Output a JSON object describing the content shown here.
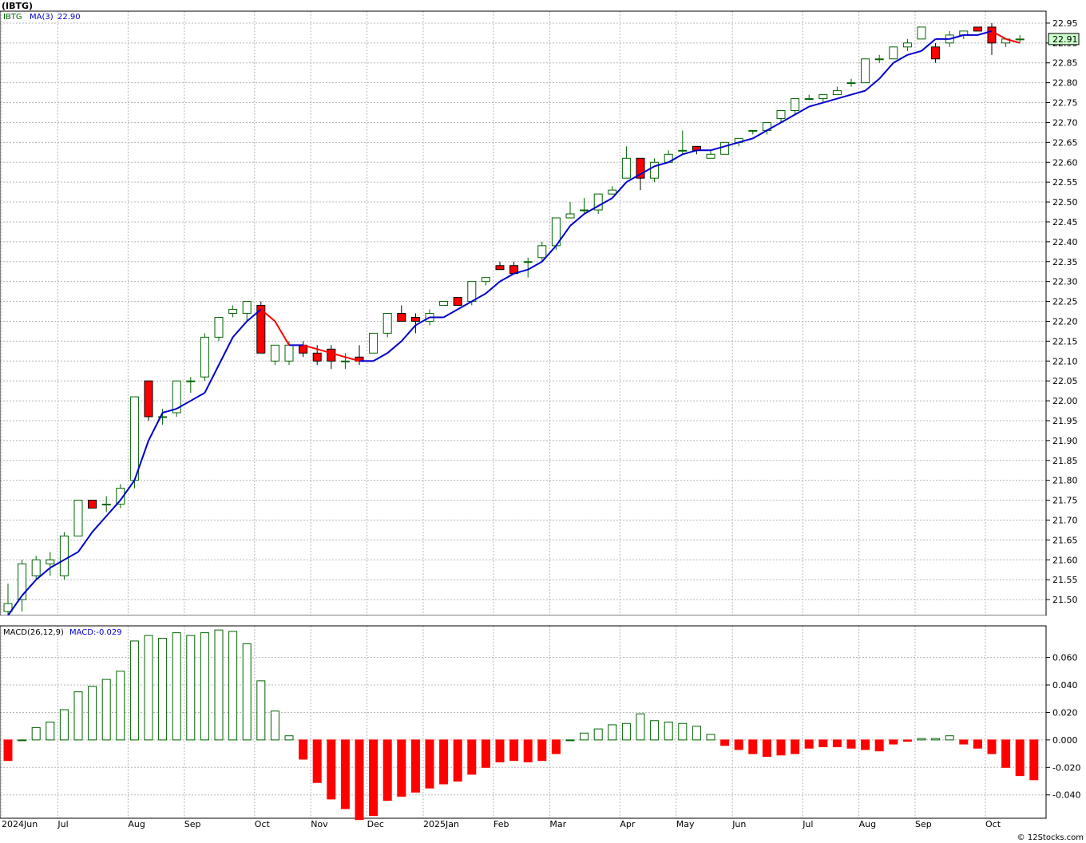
{
  "header": {
    "ticker_title": "(IBTG)"
  },
  "footer": {
    "watermark": "© 12Stocks.com"
  },
  "colors": {
    "up": "#006400",
    "down": "#ff0000",
    "ma_up": "#0000cc",
    "ma_down": "#ff0000",
    "grid": "#b8b8b8",
    "frame": "#000000",
    "price_tag_bg": "#ccffcc"
  },
  "chart_data": [
    {
      "type": "candlestick",
      "panel": "price",
      "ticker_label": "IBTG",
      "ma_label": "MA(3)",
      "ma_value_label": "22.90",
      "last_price_label": "22.91",
      "ylim": [
        21.46,
        22.98
      ],
      "y_ticks": [
        "21.50",
        "21.55",
        "21.60",
        "21.65",
        "21.70",
        "21.75",
        "21.80",
        "21.85",
        "21.90",
        "21.95",
        "22.00",
        "22.05",
        "22.10",
        "22.15",
        "22.20",
        "22.25",
        "22.30",
        "22.35",
        "22.40",
        "22.45",
        "22.50",
        "22.55",
        "22.60",
        "22.65",
        "22.70",
        "22.75",
        "22.80",
        "22.85",
        "22.90",
        "22.95"
      ],
      "x_labels": [
        "2024Jun",
        "Jul",
        "Aug",
        "Sep",
        "Oct",
        "Nov",
        "Dec",
        "2025Jan",
        "Feb",
        "Mar",
        "Apr",
        "May",
        "Jun",
        "Jul",
        "Aug",
        "Sep",
        "Oct"
      ],
      "candles": [
        {
          "o": 21.47,
          "h": 21.54,
          "l": 21.46,
          "c": 21.49
        },
        {
          "o": 21.5,
          "h": 21.6,
          "l": 21.47,
          "c": 21.59
        },
        {
          "o": 21.56,
          "h": 21.61,
          "l": 21.55,
          "c": 21.6
        },
        {
          "o": 21.59,
          "h": 21.62,
          "l": 21.56,
          "c": 21.6
        },
        {
          "o": 21.56,
          "h": 21.67,
          "l": 21.55,
          "c": 21.66
        },
        {
          "o": 21.66,
          "h": 21.75,
          "l": 21.66,
          "c": 21.75
        },
        {
          "o": 21.75,
          "h": 21.75,
          "l": 21.73,
          "c": 21.73
        },
        {
          "o": 21.74,
          "h": 21.76,
          "l": 21.72,
          "c": 21.74
        },
        {
          "o": 21.74,
          "h": 21.79,
          "l": 21.73,
          "c": 21.78
        },
        {
          "o": 21.8,
          "h": 22.01,
          "l": 21.78,
          "c": 22.01
        },
        {
          "o": 22.05,
          "h": 22.05,
          "l": 21.95,
          "c": 21.96
        },
        {
          "o": 21.96,
          "h": 21.98,
          "l": 21.94,
          "c": 21.96
        },
        {
          "o": 21.97,
          "h": 22.05,
          "l": 21.96,
          "c": 22.05
        },
        {
          "o": 22.05,
          "h": 22.06,
          "l": 22.02,
          "c": 22.05
        },
        {
          "o": 22.06,
          "h": 22.17,
          "l": 22.05,
          "c": 22.16
        },
        {
          "o": 22.16,
          "h": 22.21,
          "l": 22.15,
          "c": 22.21
        },
        {
          "o": 22.22,
          "h": 22.24,
          "l": 22.21,
          "c": 22.23
        },
        {
          "o": 22.22,
          "h": 22.25,
          "l": 22.2,
          "c": 22.25
        },
        {
          "o": 22.24,
          "h": 22.25,
          "l": 22.12,
          "c": 22.12
        },
        {
          "o": 22.1,
          "h": 22.14,
          "l": 22.09,
          "c": 22.14
        },
        {
          "o": 22.1,
          "h": 22.15,
          "l": 22.09,
          "c": 22.14
        },
        {
          "o": 22.14,
          "h": 22.15,
          "l": 22.11,
          "c": 22.12
        },
        {
          "o": 22.12,
          "h": 22.14,
          "l": 22.09,
          "c": 22.1
        },
        {
          "o": 22.13,
          "h": 22.14,
          "l": 22.08,
          "c": 22.1
        },
        {
          "o": 22.1,
          "h": 22.12,
          "l": 22.08,
          "c": 22.1
        },
        {
          "o": 22.11,
          "h": 22.14,
          "l": 22.09,
          "c": 22.1
        },
        {
          "o": 22.12,
          "h": 22.17,
          "l": 22.12,
          "c": 22.17
        },
        {
          "o": 22.17,
          "h": 22.22,
          "l": 22.16,
          "c": 22.22
        },
        {
          "o": 22.22,
          "h": 22.24,
          "l": 22.2,
          "c": 22.2
        },
        {
          "o": 22.21,
          "h": 22.22,
          "l": 22.17,
          "c": 22.2
        },
        {
          "o": 22.2,
          "h": 22.23,
          "l": 22.19,
          "c": 22.22
        },
        {
          "o": 22.24,
          "h": 22.25,
          "l": 22.24,
          "c": 22.25
        },
        {
          "o": 22.26,
          "h": 22.26,
          "l": 22.24,
          "c": 22.24
        },
        {
          "o": 22.25,
          "h": 22.3,
          "l": 22.24,
          "c": 22.3
        },
        {
          "o": 22.3,
          "h": 22.31,
          "l": 22.29,
          "c": 22.31
        },
        {
          "o": 22.34,
          "h": 22.35,
          "l": 22.33,
          "c": 22.33
        },
        {
          "o": 22.34,
          "h": 22.35,
          "l": 22.32,
          "c": 22.32
        },
        {
          "o": 22.35,
          "h": 22.36,
          "l": 22.31,
          "c": 22.35
        },
        {
          "o": 22.36,
          "h": 22.4,
          "l": 22.35,
          "c": 22.39
        },
        {
          "o": 22.39,
          "h": 22.46,
          "l": 22.38,
          "c": 22.46
        },
        {
          "o": 22.46,
          "h": 22.5,
          "l": 22.46,
          "c": 22.47
        },
        {
          "o": 22.48,
          "h": 22.51,
          "l": 22.47,
          "c": 22.48
        },
        {
          "o": 22.48,
          "h": 22.52,
          "l": 22.47,
          "c": 22.52
        },
        {
          "o": 22.52,
          "h": 22.54,
          "l": 22.52,
          "c": 22.53
        },
        {
          "o": 22.56,
          "h": 22.64,
          "l": 22.56,
          "c": 22.61
        },
        {
          "o": 22.61,
          "h": 22.61,
          "l": 22.53,
          "c": 22.56
        },
        {
          "o": 22.56,
          "h": 22.61,
          "l": 22.55,
          "c": 22.6
        },
        {
          "o": 22.6,
          "h": 22.63,
          "l": 22.6,
          "c": 22.62
        },
        {
          "o": 22.63,
          "h": 22.68,
          "l": 22.62,
          "c": 22.63
        },
        {
          "o": 22.64,
          "h": 22.64,
          "l": 22.62,
          "c": 22.63
        },
        {
          "o": 22.61,
          "h": 22.63,
          "l": 22.61,
          "c": 22.62
        },
        {
          "o": 22.62,
          "h": 22.65,
          "l": 22.62,
          "c": 22.65
        },
        {
          "o": 22.65,
          "h": 22.66,
          "l": 22.64,
          "c": 22.66
        },
        {
          "o": 22.68,
          "h": 22.68,
          "l": 22.67,
          "c": 22.68
        },
        {
          "o": 22.68,
          "h": 22.7,
          "l": 22.67,
          "c": 22.7
        },
        {
          "o": 22.71,
          "h": 22.73,
          "l": 22.7,
          "c": 22.73
        },
        {
          "o": 22.73,
          "h": 22.76,
          "l": 22.72,
          "c": 22.76
        },
        {
          "o": 22.76,
          "h": 22.77,
          "l": 22.76,
          "c": 22.76
        },
        {
          "o": 22.76,
          "h": 22.77,
          "l": 22.75,
          "c": 22.77
        },
        {
          "o": 22.77,
          "h": 22.79,
          "l": 22.77,
          "c": 22.78
        },
        {
          "o": 22.8,
          "h": 22.81,
          "l": 22.79,
          "c": 22.8
        },
        {
          "o": 22.8,
          "h": 22.86,
          "l": 22.8,
          "c": 22.86
        },
        {
          "o": 22.86,
          "h": 22.87,
          "l": 22.85,
          "c": 22.86
        },
        {
          "o": 22.86,
          "h": 22.89,
          "l": 22.86,
          "c": 22.89
        },
        {
          "o": 22.89,
          "h": 22.91,
          "l": 22.88,
          "c": 22.9
        },
        {
          "o": 22.91,
          "h": 22.94,
          "l": 22.91,
          "c": 22.94
        },
        {
          "o": 22.89,
          "h": 22.9,
          "l": 22.85,
          "c": 22.86
        },
        {
          "o": 22.9,
          "h": 22.93,
          "l": 22.89,
          "c": 22.92
        },
        {
          "o": 22.92,
          "h": 22.93,
          "l": 22.91,
          "c": 22.93
        },
        {
          "o": 22.94,
          "h": 22.94,
          "l": 22.93,
          "c": 22.93
        },
        {
          "o": 22.94,
          "h": 22.95,
          "l": 22.87,
          "c": 22.9
        },
        {
          "o": 22.9,
          "h": 22.91,
          "l": 22.89,
          "c": 22.91
        },
        {
          "o": 22.91,
          "h": 22.92,
          "l": 22.9,
          "c": 22.91
        }
      ],
      "ma": [
        21.46,
        21.51,
        21.55,
        21.58,
        21.6,
        21.62,
        21.67,
        21.71,
        21.75,
        21.8,
        21.9,
        21.97,
        21.98,
        22.0,
        22.02,
        22.09,
        22.16,
        22.2,
        22.23,
        22.2,
        22.14,
        22.14,
        22.13,
        22.12,
        22.11,
        22.1,
        22.1,
        22.12,
        22.15,
        22.19,
        22.21,
        22.21,
        22.23,
        22.25,
        22.27,
        22.3,
        22.32,
        22.33,
        22.35,
        22.39,
        22.44,
        22.47,
        22.49,
        22.51,
        22.55,
        22.57,
        22.59,
        22.6,
        22.62,
        22.63,
        22.63,
        22.64,
        22.65,
        22.66,
        22.68,
        22.7,
        22.72,
        22.74,
        22.75,
        22.76,
        22.77,
        22.78,
        22.81,
        22.85,
        22.87,
        22.88,
        22.91,
        22.91,
        22.92,
        22.92,
        22.93,
        22.91,
        22.9
      ]
    },
    {
      "type": "bar",
      "panel": "macd",
      "label": "MACD(26,12,9)",
      "value_label": "MACD:-0.029",
      "ylim": [
        -0.057,
        0.083
      ],
      "y_ticks": [
        "0.060",
        "0.040",
        "0.020",
        "0.000",
        "-0.020",
        "-0.040"
      ],
      "x_labels": [
        "2024Jun",
        "Jul",
        "Aug",
        "Sep",
        "Oct",
        "Nov",
        "Dec",
        "2025Jan",
        "Feb",
        "Mar",
        "Apr",
        "May",
        "Jun",
        "Jul",
        "Aug",
        "Sep",
        "Oct"
      ],
      "values": [
        -0.015,
        0.0,
        0.009,
        0.013,
        0.022,
        0.035,
        0.039,
        0.044,
        0.05,
        0.072,
        0.076,
        0.074,
        0.078,
        0.076,
        0.078,
        0.08,
        0.079,
        0.07,
        0.043,
        0.021,
        0.003,
        -0.014,
        -0.031,
        -0.043,
        -0.05,
        -0.058,
        -0.055,
        -0.044,
        -0.041,
        -0.038,
        -0.035,
        -0.032,
        -0.03,
        -0.025,
        -0.02,
        -0.016,
        -0.015,
        -0.016,
        -0.015,
        -0.01,
        0.0,
        0.005,
        0.008,
        0.011,
        0.012,
        0.019,
        0.014,
        0.013,
        0.012,
        0.01,
        0.004,
        -0.004,
        -0.007,
        -0.01,
        -0.012,
        -0.011,
        -0.01,
        -0.006,
        -0.005,
        -0.005,
        -0.006,
        -0.007,
        -0.008,
        -0.003,
        -0.001,
        0.001,
        0.001,
        0.003,
        -0.003,
        -0.006,
        -0.01,
        -0.02,
        -0.026,
        -0.029
      ]
    }
  ]
}
